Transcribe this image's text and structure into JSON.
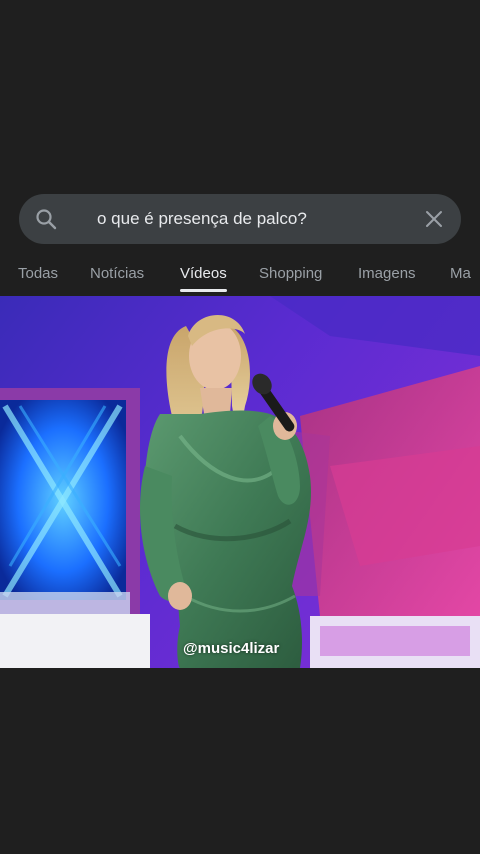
{
  "search": {
    "query": "o que é presença de palco?"
  },
  "tabs": [
    {
      "label": "Todas",
      "active": false
    },
    {
      "label": "Notícias",
      "active": false
    },
    {
      "label": "Vídeos",
      "active": true
    },
    {
      "label": "Shopping",
      "active": false
    },
    {
      "label": "Imagens",
      "active": false
    },
    {
      "label": "Ma",
      "active": false
    }
  ],
  "video": {
    "watermark": "@music4lizar"
  },
  "colors": {
    "background": "#1f1f1f",
    "search_bar": "#3c4043",
    "text_primary": "#e8eaed",
    "text_secondary": "#9aa0a6",
    "stage_purple": "#5b2bd1",
    "stage_blue": "#1b6fff",
    "stage_pink": "#e0389a",
    "dress_green": "#3f7a55"
  },
  "icons": {
    "search": "search-icon",
    "clear": "close-icon"
  }
}
